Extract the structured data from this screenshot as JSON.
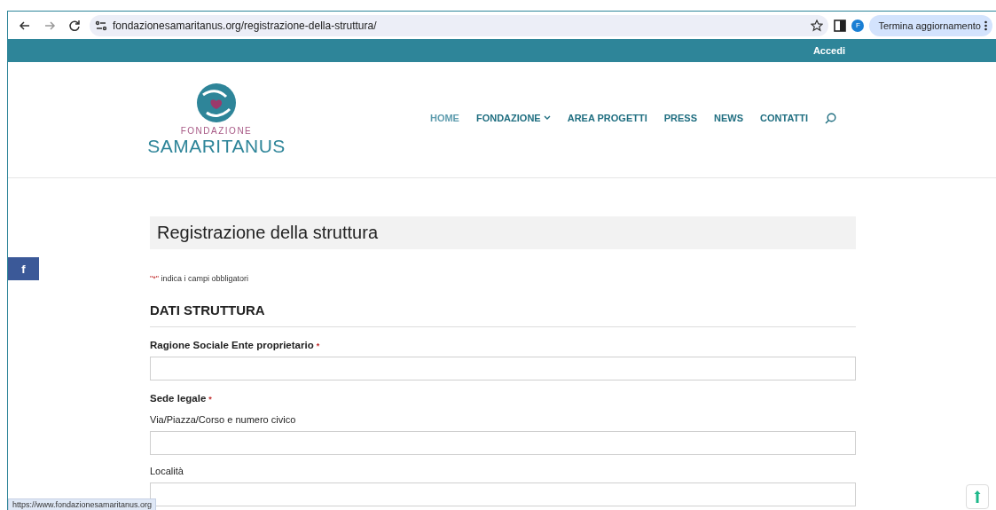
{
  "browser": {
    "url": "fondazionesamaritanus.org/registrazione-della-struttura/",
    "profile_initial": "F",
    "update_button": "Termina aggiornamento"
  },
  "top_bar": {
    "login_link": "Accedi"
  },
  "logo": {
    "line1": "FONDAZIONE",
    "line2": "SAMARITANUS"
  },
  "nav": [
    {
      "label": "HOME",
      "selected": true,
      "dropdown": false
    },
    {
      "label": "FONDAZIONE",
      "selected": false,
      "dropdown": true
    },
    {
      "label": "AREA PROGETTI",
      "selected": false,
      "dropdown": false
    },
    {
      "label": "PRESS",
      "selected": false,
      "dropdown": false
    },
    {
      "label": "NEWS",
      "selected": false,
      "dropdown": false
    },
    {
      "label": "CONTATTI",
      "selected": false,
      "dropdown": false
    }
  ],
  "social": {
    "facebook": "f"
  },
  "page_title": "Registrazione della struttura",
  "required_note": {
    "mark": "\"*\"",
    "text": "indica i campi obbligatori"
  },
  "section_title": "DATI STRUTTURA",
  "required_mark": "*",
  "fields": [
    {
      "label": "Ragione Sociale Ente proprietario",
      "required": true,
      "kind": "input"
    },
    {
      "label": "Sede legale",
      "required": true,
      "kind": "group"
    },
    {
      "label": "Via/Piazza/Corso e numero civico",
      "required": false,
      "kind": "subinput"
    },
    {
      "label": "Località",
      "required": false,
      "kind": "subinput"
    }
  ],
  "status_url": "https://www.fondazionesamaritanus.org"
}
